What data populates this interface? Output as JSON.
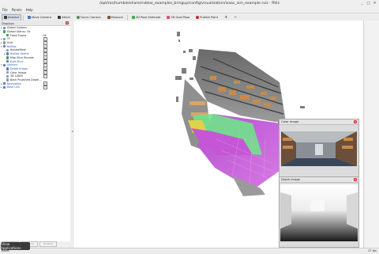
{
  "window": {
    "title": "/opt/ros/humble/share/nvblox_examples_bringup/config/visualization/isaac_sim_example.rviz - RViz",
    "minimize_icon": "minimize-icon",
    "maximize_icon": "maximize-icon",
    "close_icon": "close-icon"
  },
  "menu": [
    "File",
    "Panels",
    "Help"
  ],
  "toolbar": [
    {
      "label": "Interact",
      "icon": "cursor-icon",
      "active": true,
      "color": "#3a3a3a"
    },
    {
      "label": "Move Camera",
      "icon": "move-camera-icon",
      "active": false,
      "color": "#4a72b8"
    },
    {
      "label": "Select",
      "icon": "select-icon",
      "active": false,
      "color": "#3a3a3a"
    },
    {
      "label": "Focus Camera",
      "icon": "focus-camera-icon",
      "active": false,
      "color": "#5a8a5a"
    },
    {
      "label": "Measure",
      "icon": "measure-icon",
      "active": false,
      "color": "#7a5a3a"
    },
    {
      "label": "2D Pose Estimate",
      "icon": "pose-estimate-arrow-icon",
      "active": false,
      "color": "#3db04a"
    },
    {
      "label": "2D Goal Pose",
      "icon": "goal-pose-arrow-icon",
      "active": false,
      "color": "#d9537a"
    },
    {
      "label": "Publish Point",
      "icon": "publish-point-icon",
      "active": false,
      "color": "#c62828"
    }
  ],
  "toolbar_extra": {
    "add": "+",
    "remove": "−"
  },
  "displays_panel": {
    "title": "Displays",
    "rows": [
      {
        "indent": 0,
        "arrow": "▸",
        "label": "Global Options",
        "icon_color": "#6d8fc7",
        "blue": false,
        "value": "",
        "check": ""
      },
      {
        "indent": 0,
        "arrow": "",
        "label": "Global Status: Ok",
        "icon_color": "#3fa34d",
        "blue": false,
        "value": "",
        "check": ""
      },
      {
        "indent": 1,
        "arrow": "",
        "label": "Fixed Frame",
        "icon_color": "#3fa34d",
        "blue": false,
        "value": "OK",
        "check": ""
      },
      {
        "indent": 0,
        "arrow": "▸",
        "label": "TF",
        "icon_color": "#8a9bb5",
        "blue": false,
        "value": "",
        "check": "✓"
      },
      {
        "indent": 0,
        "arrow": "▸",
        "label": "Grid",
        "icon_color": "#8a9bb5",
        "blue": false,
        "value": "",
        "check": "✓"
      },
      {
        "indent": 0,
        "arrow": "▾",
        "label": "NvBlox",
        "icon_color": "#5b7fc0",
        "blue": true,
        "value": "",
        "check": "✓"
      },
      {
        "indent": 1,
        "arrow": "",
        "label": "NvbloxMesh",
        "icon_color": "#8a9bb5",
        "blue": false,
        "value": "",
        "check": "✓"
      },
      {
        "indent": 1,
        "arrow": "▸",
        "label": "NvBlox Voxels",
        "icon_color": "#5b7fc0",
        "blue": true,
        "value": "",
        "check": "✓"
      },
      {
        "indent": 1,
        "arrow": "",
        "label": "Map Slice Bounds",
        "icon_color": "#3fa34d",
        "blue": false,
        "value": "",
        "check": "✓"
      },
      {
        "indent": 1,
        "arrow": "",
        "label": "Esdf Slice",
        "icon_color": "#5b7fc0",
        "blue": true,
        "value": "",
        "check": "✓"
      },
      {
        "indent": 0,
        "arrow": "▾",
        "label": "Sensors",
        "icon_color": "#5b7fc0",
        "blue": true,
        "value": "",
        "check": "✓"
      },
      {
        "indent": 1,
        "arrow": "",
        "label": "Depth Image",
        "icon_color": "#5b7fc0",
        "blue": true,
        "value": "",
        "check": "✓"
      },
      {
        "indent": 1,
        "arrow": "",
        "label": "Color Image",
        "icon_color": "#8a9bb5",
        "blue": false,
        "value": "",
        "check": "✓"
      },
      {
        "indent": 1,
        "arrow": "",
        "label": "3D LiDAR",
        "icon_color": "#8a9bb5",
        "blue": false,
        "value": "",
        "check": "✓"
      },
      {
        "indent": 1,
        "arrow": "",
        "label": "Back Projected Depth...",
        "icon_color": "#8a9bb5",
        "blue": false,
        "value": "",
        "check": ""
      },
      {
        "indent": 0,
        "arrow": "▸",
        "label": "Navigation",
        "icon_color": "#5b7fc0",
        "blue": true,
        "value": "",
        "check": "✓"
      },
      {
        "indent": 0,
        "arrow": "▸",
        "label": "Base Link",
        "icon_color": "#5b7fc0",
        "blue": true,
        "value": "",
        "check": "✓"
      }
    ],
    "buttons": [
      "Add",
      "Remove",
      "Rename"
    ]
  },
  "splitter_handle": "◂",
  "color_image": {
    "title": "Color Image"
  },
  "depth_image": {
    "title": "Depth Image"
  },
  "status": {
    "left": "Reset",
    "right": "27 fps",
    "tooltip": "Show Applications"
  },
  "colors": {
    "floor_magenta": "#c557d6",
    "floor_green": "#6fe38a",
    "shelf_orange": "#c98a4a",
    "rviz_panel_close": "#c0392b"
  }
}
